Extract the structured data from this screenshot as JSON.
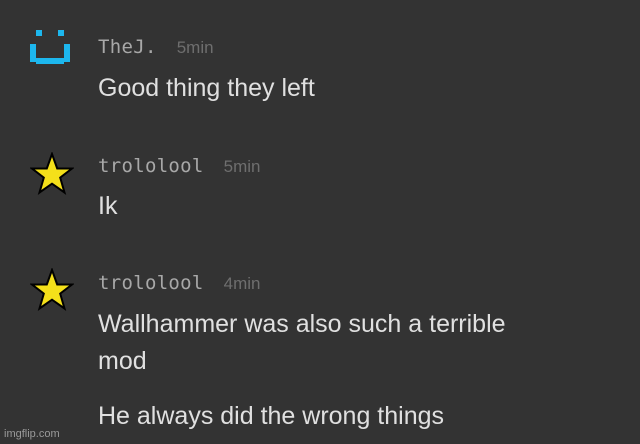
{
  "messages": [
    {
      "avatar": "smiley-icon",
      "username": "TheJ.",
      "time": "5min",
      "lines": [
        "Good thing they left"
      ]
    },
    {
      "avatar": "star-icon",
      "username": "trololool",
      "time": "5min",
      "lines": [
        "Ik"
      ]
    },
    {
      "avatar": "star-icon",
      "username": "trololool",
      "time": "4min",
      "lines": [
        "Wallhammer was also such a terrible",
        "mod",
        "He always did the wrong things"
      ]
    }
  ],
  "watermark": "imgflip.com",
  "colors": {
    "background": "#333333",
    "smiley": "#1db7ee",
    "star": "#f4e01a"
  }
}
